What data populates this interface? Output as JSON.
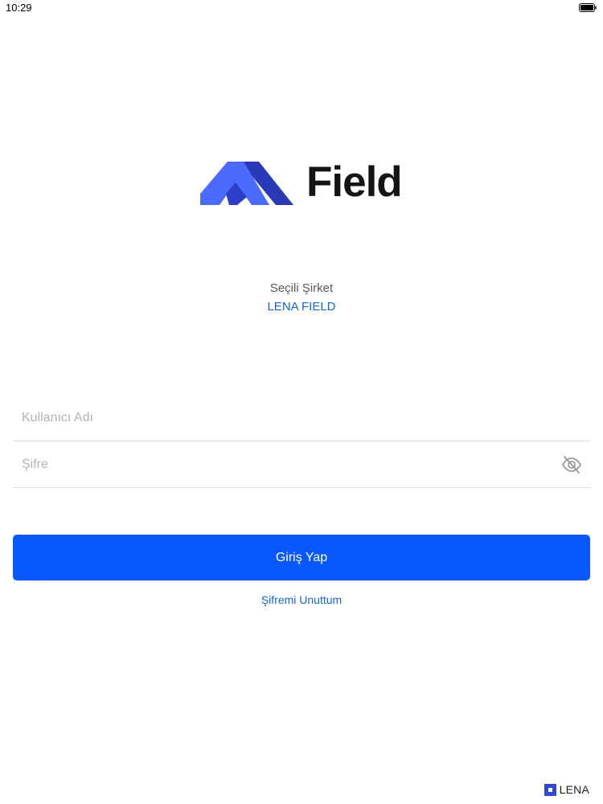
{
  "status_bar": {
    "time": "10:29",
    "battery_icon": "battery-full-icon"
  },
  "logo": {
    "word": "Field",
    "icon": "mountain-logo-icon",
    "colors": {
      "light_blue": "#4b6bff",
      "dark_blue": "#2a39b8",
      "mid_blue": "#3a50e6"
    }
  },
  "company": {
    "caption": "Seçili Şirket",
    "name": "LENA FIELD"
  },
  "form": {
    "username_placeholder": "Kullanıcı Adı",
    "password_placeholder": "Şifre",
    "password_toggle_icon": "eye-off-icon",
    "login_label": "Giriş Yap",
    "forgot_label": "Şifremi Unuttum"
  },
  "footer": {
    "brand": "LENA",
    "brand_icon": "lena-square-icon"
  },
  "colors": {
    "accent": "#0a58ff",
    "link": "#1565d8"
  }
}
